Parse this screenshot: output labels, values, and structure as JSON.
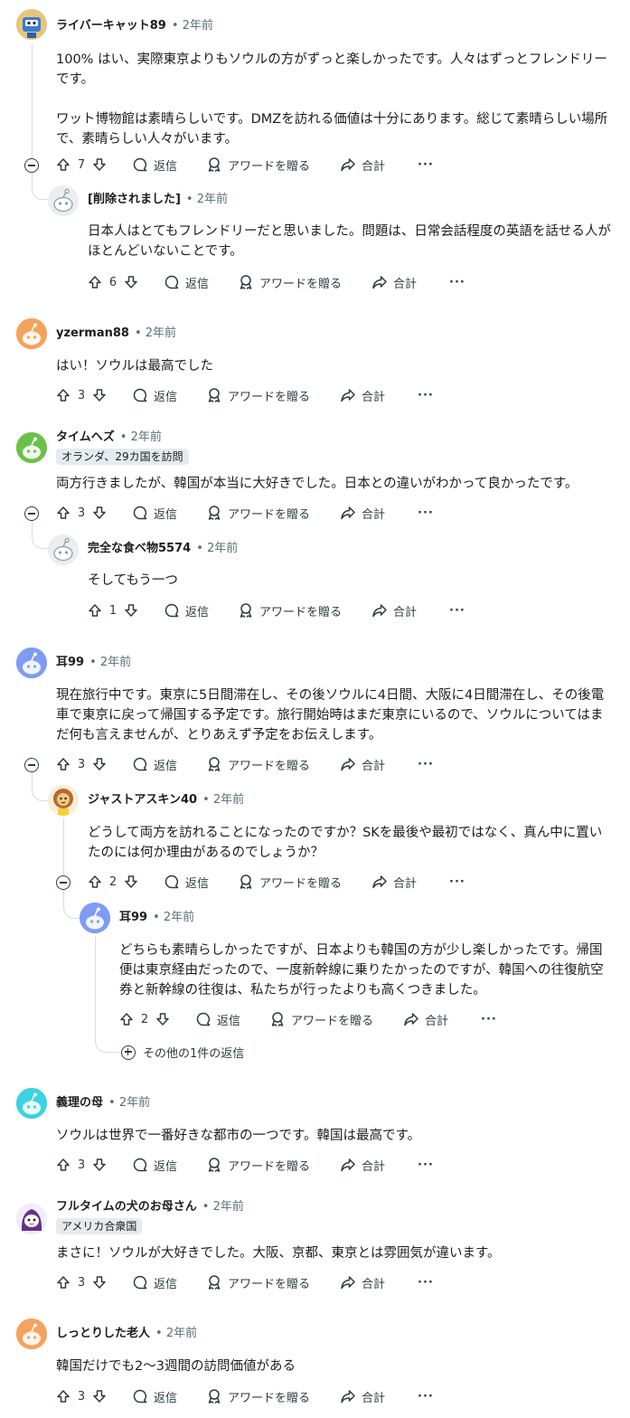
{
  "labels": {
    "reply": "返信",
    "award": "アワードを贈る",
    "share": "合計",
    "more": "···"
  },
  "comments": [
    {
      "user": "ライバーキャット89",
      "time": "2年前",
      "votes": "7",
      "p1": "100% はい、実際東京よりもソウルの方がずっと楽しかったです。人々はずっとフレンドリーです。",
      "p2": "ワット博物館は素晴らしいです。DMZを訪れる価値は十分にあります。総じて素晴らしい場所で、素晴らしい人々がいます。"
    },
    {
      "user": "[削除されました]",
      "time": "2年前",
      "votes": "6",
      "p1": "日本人はとてもフレンドリーだと思いました。問題は、日常会話程度の英語を話せる人がほとんどいないことです。"
    },
    {
      "user": "yzerman88",
      "time": "2年前",
      "votes": "3",
      "p1": "はい！ソウルは最高でした"
    },
    {
      "user": "タイムヘズ",
      "time": "2年前",
      "flair": "オランダ、29カ国を訪問",
      "votes": "3",
      "p1": "両方行きましたが、韓国が本当に大好きでした。日本との違いがわかって良かったです。"
    },
    {
      "user": "完全な食べ物5574",
      "time": "2年前",
      "votes": "1",
      "p1": "そしてもう一つ"
    },
    {
      "user": "耳99",
      "time": "2年前",
      "votes": "3",
      "p1": "現在旅行中です。東京に5日間滞在し、その後ソウルに4日間、大阪に4日間滞在し、その後電車で東京に戻って帰国する予定です。旅行開始時はまだ東京にいるので、ソウルについてはまだ何も言えませんが、とりあえず予定をお伝えします。"
    },
    {
      "user": "ジャストアスキン40",
      "time": "2年前",
      "votes": "2",
      "p1": "どうして両方を訪れることになったのですか？SKを最後や最初ではなく、真ん中に置いたのには何か理由があるのでしょうか？"
    },
    {
      "user": "耳99",
      "time": "2年前",
      "votes": "2",
      "p1": "どちらも素晴らしかったですが、日本よりも韓国の方が少し楽しかったです。帰国便は東京経由だったので、一度新幹線に乗りたかったのですが、韓国への往復航空券と新幹線の往復は、私たちが行ったよりも高くつきました。"
    },
    {
      "user": "義理の母",
      "time": "2年前",
      "votes": "3",
      "p1": "ソウルは世界で一番好きな都市の一つです。韓国は最高です。"
    },
    {
      "user": "フルタイムの犬のお母さん",
      "time": "2年前",
      "flair": "アメリカ合衆国",
      "votes": "3",
      "p1": "まさに！ソウルが大好きでした。大阪、京都、東京とは雰囲気が違います。"
    },
    {
      "user": "しっとりした老人",
      "time": "2年前",
      "votes": "3",
      "p1": "韓国だけでも2〜3週間の訪問価値がある"
    }
  ],
  "more_replies": "その他の1件の返信",
  "colors": {
    "text": "#1c1c1c",
    "meta": "#576f76",
    "icon": "#2a3c42",
    "thread_line": "#d5dcdf",
    "flair_bg": "#e5ebee"
  }
}
